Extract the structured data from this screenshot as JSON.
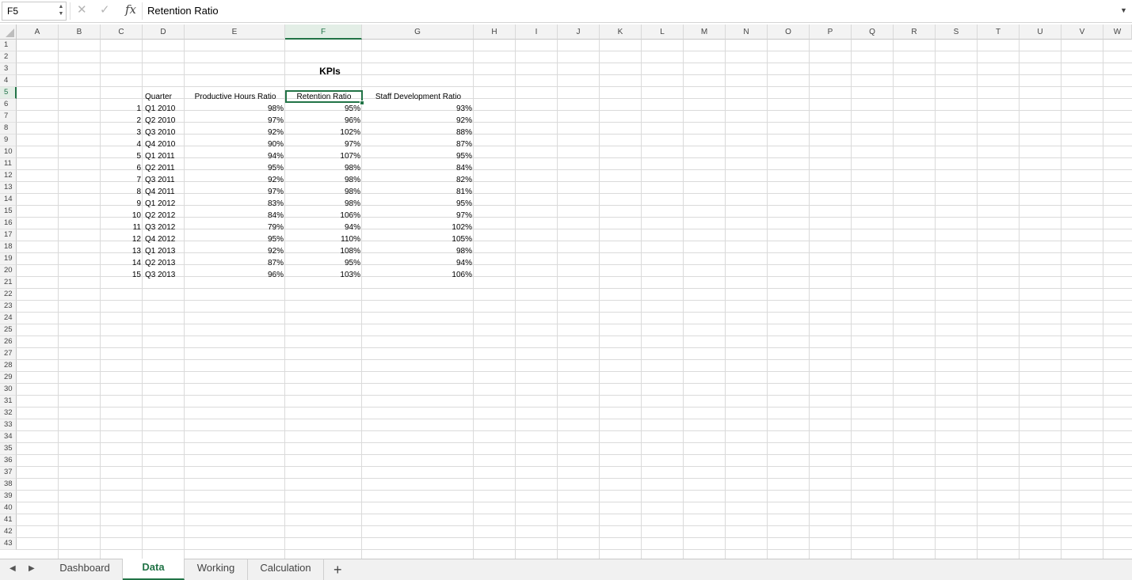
{
  "formula_bar": {
    "name_box": "F5",
    "cancel_glyph": "✕",
    "enter_glyph": "✓",
    "fx_glyph": "fx",
    "content": "Retention Ratio",
    "expand_glyph": "▼"
  },
  "columns": [
    "A",
    "B",
    "C",
    "D",
    "E",
    "F",
    "G",
    "H",
    "I",
    "J",
    "K",
    "L",
    "M",
    "N",
    "O",
    "P",
    "Q",
    "R",
    "S",
    "T",
    "U",
    "V",
    "W"
  ],
  "selected_column": "F",
  "selected_row": 5,
  "rows_visible": 43,
  "title": "KPIs",
  "headers": {
    "quarter": "Quarter",
    "productive": "Productive Hours Ratio",
    "retention": "Retention Ratio",
    "staff": "Staff Development Ratio"
  },
  "table": [
    {
      "n": "1",
      "quarter": "Q1 2010",
      "productive": "98%",
      "retention": "95%",
      "staff": "93%"
    },
    {
      "n": "2",
      "quarter": "Q2 2010",
      "productive": "97%",
      "retention": "96%",
      "staff": "92%"
    },
    {
      "n": "3",
      "quarter": "Q3 2010",
      "productive": "92%",
      "retention": "102%",
      "staff": "88%"
    },
    {
      "n": "4",
      "quarter": "Q4 2010",
      "productive": "90%",
      "retention": "97%",
      "staff": "87%"
    },
    {
      "n": "5",
      "quarter": "Q1 2011",
      "productive": "94%",
      "retention": "107%",
      "staff": "95%"
    },
    {
      "n": "6",
      "quarter": "Q2 2011",
      "productive": "95%",
      "retention": "98%",
      "staff": "84%"
    },
    {
      "n": "7",
      "quarter": "Q3 2011",
      "productive": "92%",
      "retention": "98%",
      "staff": "82%"
    },
    {
      "n": "8",
      "quarter": "Q4 2011",
      "productive": "97%",
      "retention": "98%",
      "staff": "81%"
    },
    {
      "n": "9",
      "quarter": "Q1 2012",
      "productive": "83%",
      "retention": "98%",
      "staff": "95%"
    },
    {
      "n": "10",
      "quarter": "Q2 2012",
      "productive": "84%",
      "retention": "106%",
      "staff": "97%"
    },
    {
      "n": "11",
      "quarter": "Q3 2012",
      "productive": "79%",
      "retention": "94%",
      "staff": "102%"
    },
    {
      "n": "12",
      "quarter": "Q4 2012",
      "productive": "95%",
      "retention": "110%",
      "staff": "105%"
    },
    {
      "n": "13",
      "quarter": "Q1 2013",
      "productive": "92%",
      "retention": "108%",
      "staff": "98%"
    },
    {
      "n": "14",
      "quarter": "Q2 2013",
      "productive": "87%",
      "retention": "95%",
      "staff": "94%"
    },
    {
      "n": "15",
      "quarter": "Q3 2013",
      "productive": "96%",
      "retention": "103%",
      "staff": "106%"
    }
  ],
  "sheet_tabs": [
    {
      "label": "Dashboard",
      "active": false
    },
    {
      "label": "Data",
      "active": true
    },
    {
      "label": "Working",
      "active": false
    },
    {
      "label": "Calculation",
      "active": false
    }
  ],
  "add_sheet_glyph": "+",
  "nav_prev_glyph": "◀",
  "nav_next_glyph": "▶",
  "colors": {
    "accent": "#217346",
    "gridline": "#dadada",
    "header_bg": "#f3f3f3"
  }
}
